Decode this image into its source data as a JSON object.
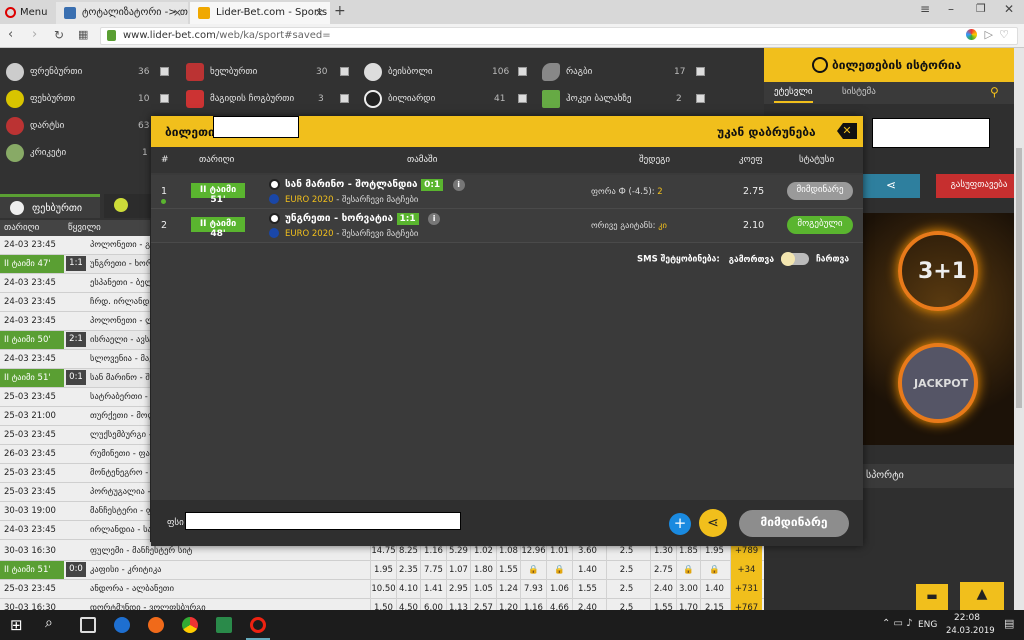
{
  "browser": {
    "tabs": [
      {
        "label": "Menu"
      },
      {
        "label": "ტოტალიზატორი -> თმ"
      },
      {
        "label": "Lider-Bet.com - Sports and"
      }
    ],
    "url_host": "www.lider-bet.com",
    "url_path": "/web/ka/sport#saved="
  },
  "sports": [
    {
      "name": "ფრენბურთი",
      "count": "36"
    },
    {
      "name": "ფეხბურთი",
      "count": "10"
    },
    {
      "name": "დარტსი",
      "count": "63"
    },
    {
      "name": "კრიკეტი",
      "count": "1"
    },
    {
      "name": "ხელბურთი",
      "count": "30"
    },
    {
      "name": "მაგიდის ჩოგბურთი",
      "count": "3"
    },
    {
      "name": "ბეისბოლი",
      "count": "106"
    },
    {
      "name": "ბილიარდი",
      "count": "41"
    },
    {
      "name": "რაგბი",
      "count": "17"
    },
    {
      "name": "ჰოკეი ბალახზე",
      "count": "2"
    }
  ],
  "left_tabs": {
    "football": "ფეხბურთი"
  },
  "left_header": {
    "date": "თარიღი",
    "pair": "წყვილი"
  },
  "left_rows": [
    {
      "date": "24-03 23:45",
      "score": "",
      "teams": "პოლონეთი - გერმანი"
    },
    {
      "date": "II ტაიმი 47'",
      "score": "1:1",
      "teams": "უნგრეთი - ხორ",
      "live": true
    },
    {
      "date": "24-03 23:45",
      "score": "",
      "teams": "ესპანეთი - ბელგია"
    },
    {
      "date": "24-03 23:45",
      "score": "",
      "teams": "ჩრდ. ირლანდია - ბელ"
    },
    {
      "date": "24-03 23:45",
      "score": "",
      "teams": "პოლონეთი - ლატვია"
    },
    {
      "date": "II ტაიმი 50'",
      "score": "2:1",
      "teams": "ისრაელი - ავსტ",
      "live": true
    },
    {
      "date": "24-03 23:45",
      "score": "",
      "teams": "სლოვენია - მაკედონ"
    },
    {
      "date": "II ტაიმი 51'",
      "score": "0:1",
      "teams": "სან მარინო - შო",
      "live": true
    },
    {
      "date": "25-03 23:45",
      "score": "",
      "teams": "სატრაბერთი - ესპანეთი"
    },
    {
      "date": "25-03 21:00",
      "score": "",
      "teams": "თურქეთი - მოლდოვა"
    },
    {
      "date": "25-03 23:45",
      "score": "",
      "teams": "ლუქსემბურგი - უკრაინ"
    },
    {
      "date": "26-03 23:45",
      "score": "",
      "teams": "რუმინეთი - ფარერებ"
    },
    {
      "date": "25-03 23:45",
      "score": "",
      "teams": "მონტენეგრო - სერბ"
    },
    {
      "date": "25-03 23:45",
      "score": "",
      "teams": "პორტუგალია - ინგლ"
    },
    {
      "date": "30-03 19:00",
      "score": "",
      "teams": "მანჩესტერი - ფორესტ"
    },
    {
      "date": "24-03 23:45",
      "score": "",
      "teams": "ირლანდია - სატართ"
    },
    {
      "date": "24-03 23:00",
      "score": "",
      "teams": "გრანადა - ლასპალმას"
    },
    {
      "date": "II ტაიმი 50'",
      "score": "2:0",
      "teams": "ირლანდია U21",
      "live": true
    }
  ],
  "odds_rows": [
    {
      "date": "30-03 16:30",
      "score": "",
      "teams": "ფულემი - მანჩესტერ სიტ",
      "cells": [
        "14.75",
        "8.25",
        "1.16",
        "5.29",
        "1.02",
        "1.08",
        "12.96",
        "1.01",
        "3.60",
        "2.5",
        "1.30",
        "1.85",
        "1.95",
        "+789"
      ]
    },
    {
      "date": "II ტაიმი 51'",
      "score": "0:0",
      "teams": "კაფისი - კრიტიკა",
      "live": true,
      "cells": [
        "1.95",
        "2.35",
        "7.75",
        "1.07",
        "1.80",
        "1.55",
        "",
        "",
        "1.40",
        "2.5",
        "2.75",
        "",
        "",
        "+34"
      ]
    },
    {
      "date": "25-03 23:45",
      "score": "",
      "teams": "ანდორა - ალბანეთი",
      "cells": [
        "10.50",
        "4.10",
        "1.41",
        "2.95",
        "1.05",
        "1.24",
        "7.93",
        "1.06",
        "1.55",
        "2.5",
        "2.40",
        "3.00",
        "1.40",
        "+731"
      ]
    },
    {
      "date": "30-03 16:30",
      "score": "",
      "teams": "დორტმუნდი - ვოლფსბურგი",
      "cells": [
        "1.50",
        "4.50",
        "6.00",
        "1.13",
        "2.57",
        "1.20",
        "1.16",
        "4.66",
        "2.40",
        "2.5",
        "1.55",
        "1.70",
        "2.15",
        "+767"
      ]
    }
  ],
  "right": {
    "history_title": "ბილეთების ისტორია",
    "tabs": [
      "ეტესვლი",
      "სისტემა"
    ],
    "clear_label": "გასუფთავება",
    "promo_text": "3+1",
    "jackpot": "JACKPOT",
    "sports_label": "სპორტი"
  },
  "modal": {
    "title": "ბილეთი",
    "back_label": "უკან დაბრუნება",
    "headers": [
      "#",
      "თარიღი",
      "თამაში",
      "შედეგი",
      "კოეფ",
      "სტატუსი"
    ],
    "rows": [
      {
        "num": "1",
        "live": "II ტაიმი 51'",
        "match": "სან მარინო - შოტლანდია",
        "score": "0:1",
        "league": "EURO 2020",
        "league_sub": "- შესარჩევი მატჩები",
        "outcome_label": "ფორა Ф (-4.5):",
        "outcome_value": "2",
        "odds": "2.75",
        "status": "მიმდინარე"
      },
      {
        "num": "2",
        "live": "II ტაიმი 48'",
        "match": "უნგრეთი - ხორვატია",
        "score": "1:1",
        "league": "EURO 2020",
        "league_sub": "- შესარჩევი მატჩები",
        "outcome_label": "ორივე გაიტანს:",
        "outcome_value": "კი",
        "odds": "2.10",
        "status": "მოგებული"
      }
    ],
    "sms_label": "SMS შეტყობინება:",
    "sms_off": "გამორთვა",
    "sms_on": "ჩართვა",
    "footer_label": "ფსი",
    "plus": "+",
    "current_button": "მიმდინარე"
  },
  "taskbar": {
    "lang": "ENG",
    "time": "22:08",
    "date": "24.03.2019"
  },
  "colors": {
    "yellow": "#f1bf1c",
    "green": "#5ab52f",
    "red": "#c62f2f"
  }
}
